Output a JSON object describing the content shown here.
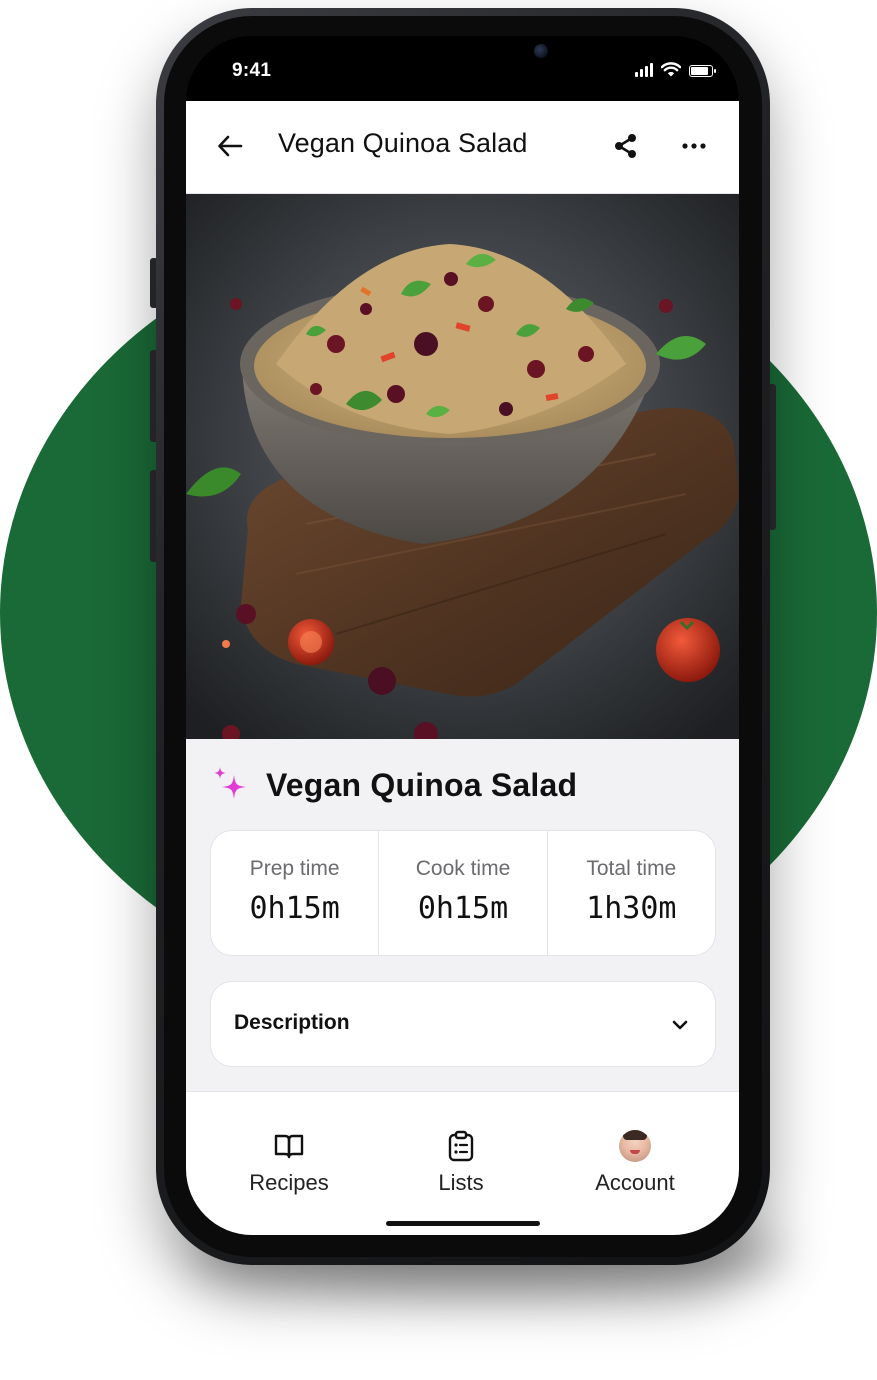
{
  "theme": {
    "backdrop_green": "#1a6a37",
    "sparkle_color": "#e23bd3",
    "screen_bg": "#f2f2f5"
  },
  "status_bar": {
    "time": "9:41",
    "icons": [
      "signal-icon",
      "wifi-icon",
      "battery-icon"
    ],
    "battery_level": 0.9
  },
  "header": {
    "title": "Vegan Quinoa Salad",
    "icons": {
      "back": "back-arrow-icon",
      "share": "share-icon",
      "more": "more-horizontal-icon"
    }
  },
  "hero": {
    "image_alt": "Bowl of quinoa salad with cranberries, herbs and tomatoes on a wooden board"
  },
  "recipe": {
    "title": "Vegan Quinoa Salad",
    "title_icon": "sparkle-icon",
    "times": [
      {
        "label": "Prep time",
        "value": "0h15m"
      },
      {
        "label": "Cook time",
        "value": "0h15m"
      },
      {
        "label": "Total time",
        "value": "1h30m"
      }
    ],
    "description": {
      "label": "Description",
      "icon": "chevron-down-icon"
    }
  },
  "tab_bar": {
    "items": [
      {
        "label": "Recipes",
        "icon": "book-icon"
      },
      {
        "label": "Lists",
        "icon": "clipboard-list-icon"
      },
      {
        "label": "Account",
        "icon": "avatar"
      }
    ]
  }
}
